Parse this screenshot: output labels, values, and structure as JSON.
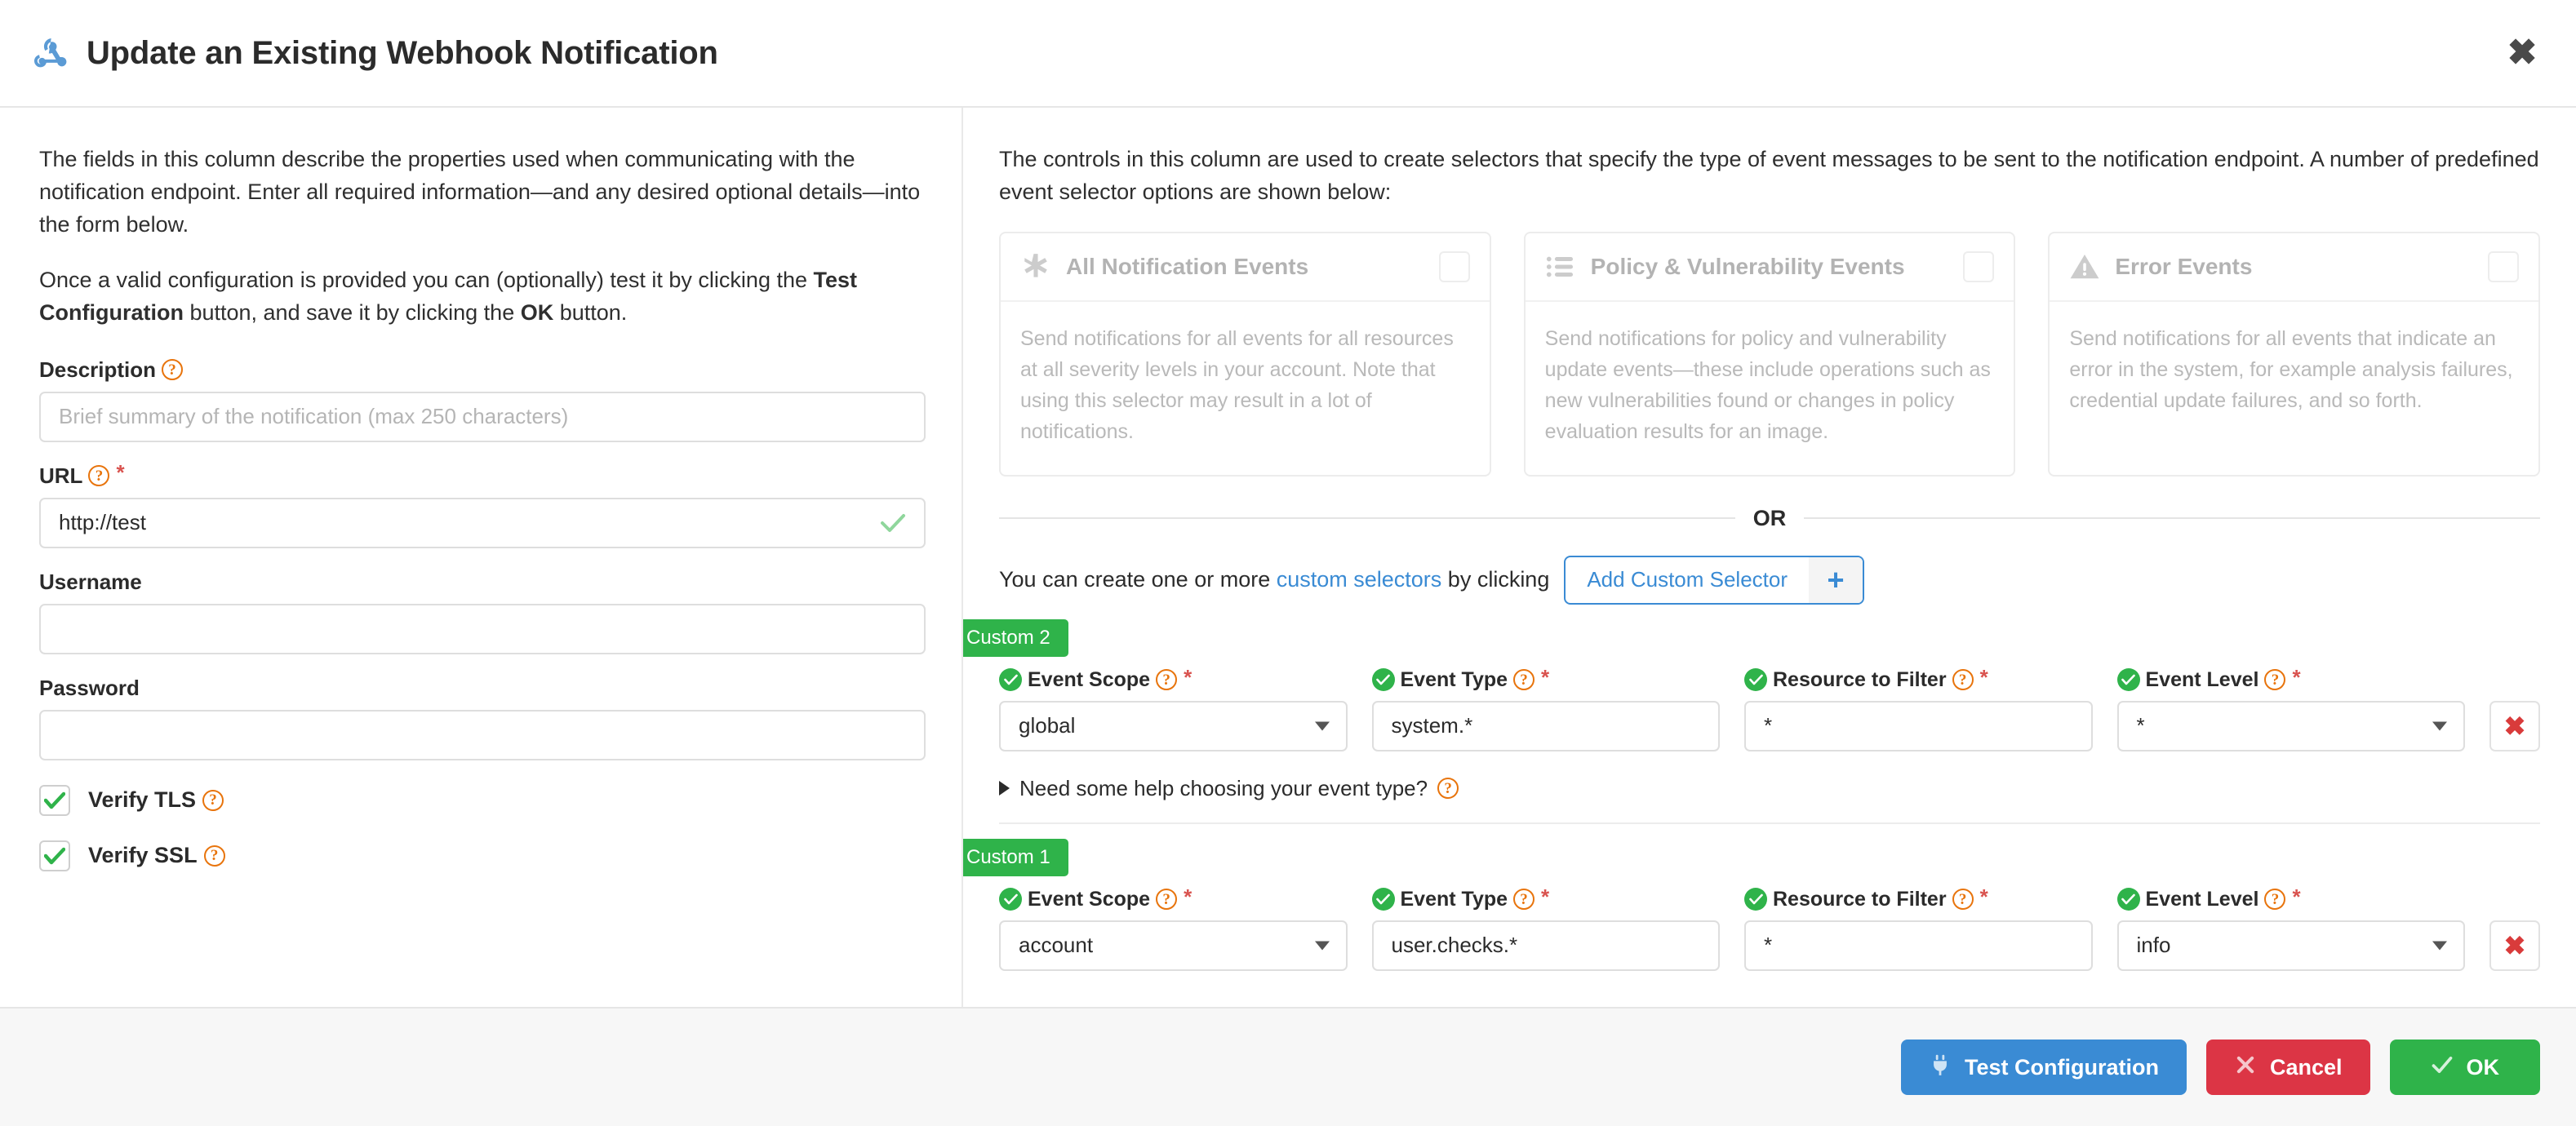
{
  "header": {
    "title": "Update an Existing Webhook Notification",
    "icon": "webhook-icon",
    "close_icon": "close-icon"
  },
  "left_column": {
    "intro_1_a": "The fields in this column describe the properties used when communicating with the notification endpoint. Enter all required information—and any desired optional details—into the form below.",
    "intro_2_a": "Once a valid configuration is provided you can (optionally) test it by clicking the ",
    "intro_2_b": "Test Configuration",
    "intro_2_c": " button, and save it by clicking the ",
    "intro_2_d": "OK",
    "intro_2_e": " button.",
    "fields": {
      "description": {
        "label": "Description",
        "value": "",
        "placeholder": "Brief summary of the notification (max 250 characters)",
        "required": false,
        "help": "?"
      },
      "url": {
        "label": "URL",
        "value": "http://test",
        "placeholder": "",
        "required": true,
        "valid": true,
        "help": "?"
      },
      "username": {
        "label": "Username",
        "value": "",
        "placeholder": "",
        "required": false
      },
      "password": {
        "label": "Password",
        "value": "",
        "placeholder": "",
        "required": false
      }
    },
    "checkboxes": [
      {
        "label": "Verify TLS",
        "checked": true,
        "help": "?"
      },
      {
        "label": "Verify SSL",
        "checked": true,
        "help": "?"
      }
    ]
  },
  "right_column": {
    "intro": "The controls in this column are used to create selectors that specify the type of event messages to be sent to the notification endpoint. A number of predefined event selector options are shown below:",
    "predefined_cards": [
      {
        "icon": "asterisk-icon",
        "title": "All Notification Events",
        "body": "Send notifications for all events for all resources at all severity levels in your account. Note that using this selector may result in a lot of notifications.",
        "checked": false
      },
      {
        "icon": "list-icon",
        "title": "Policy & Vulnerability Events",
        "body": "Send notifications for policy and vulnerability update events—these include operations such as new vulnerabilities found or changes in policy evaluation results for an image.",
        "checked": false
      },
      {
        "icon": "warning-triangle-icon",
        "title": "Error Events",
        "body": "Send notifications for all events that indicate an error in the system, for example analysis failures, credential update failures, and so forth.",
        "checked": false
      }
    ],
    "or_label": "OR",
    "add_selector": {
      "text_before": "You can create one or more ",
      "link_text": "custom selectors",
      "text_after": " by clicking",
      "button_label": "Add Custom Selector",
      "plus_icon": "plus-icon"
    },
    "help_toggle": {
      "label": "Need some help choosing your event type?",
      "help": "?",
      "expanded": false
    },
    "selectors": [
      {
        "ribbon": "Custom 2",
        "fields": [
          {
            "label": "Event Scope",
            "value": "global",
            "type": "select",
            "required": true,
            "valid": true,
            "help": "?"
          },
          {
            "label": "Event Type",
            "value": "system.*",
            "type": "text",
            "required": true,
            "valid": true,
            "help": "?"
          },
          {
            "label": "Resource to Filter",
            "value": "*",
            "type": "text",
            "required": true,
            "valid": true,
            "help": "?"
          },
          {
            "label": "Event Level",
            "value": "*",
            "type": "select",
            "required": true,
            "valid": true,
            "help": "?"
          }
        ],
        "delete_icon": "delete-x-icon"
      },
      {
        "ribbon": "Custom 1",
        "fields": [
          {
            "label": "Event Scope",
            "value": "account",
            "type": "select",
            "required": true,
            "valid": true,
            "help": "?"
          },
          {
            "label": "Event Type",
            "value": "user.checks.*",
            "type": "text",
            "required": true,
            "valid": true,
            "help": "?"
          },
          {
            "label": "Resource to Filter",
            "value": "*",
            "type": "text",
            "required": true,
            "valid": true,
            "help": "?"
          },
          {
            "label": "Event Level",
            "value": "info",
            "type": "select",
            "required": true,
            "valid": true,
            "help": "?"
          }
        ],
        "delete_icon": "delete-x-icon"
      }
    ]
  },
  "footer": {
    "test_label": "Test Configuration",
    "cancel_label": "Cancel",
    "ok_label": "OK"
  },
  "colors": {
    "brand_blue": "#3a8bd4",
    "green": "#2fb34a",
    "red": "#dc3545",
    "orange_help": "#e8740c",
    "required_star": "#d9534f"
  }
}
